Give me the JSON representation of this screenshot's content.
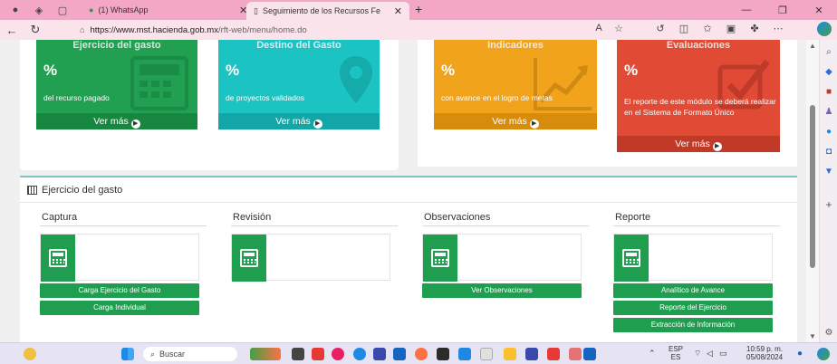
{
  "browser": {
    "tabs": [
      {
        "label": "(1) WhatsApp",
        "active": false
      },
      {
        "label": "Seguimiento de los Recursos Fe",
        "active": true
      }
    ],
    "url": {
      "host": "https://www.mst.hacienda.gob.mx",
      "path": "/rft-web/menu/home.do"
    }
  },
  "cards": [
    {
      "title": "Ejercicio del gasto",
      "value": "%",
      "desc": "del recurso pagado",
      "more": "Ver más",
      "color": "#20a050"
    },
    {
      "title": "Destino del Gasto",
      "value": "%",
      "desc": "de proyectos validados",
      "more": "Ver más",
      "color": "#1bc3c3"
    },
    {
      "title": "Indicadores",
      "value": "%",
      "desc": "con avance en el logro de metas",
      "more": "Ver más",
      "color": "#f2a31c"
    },
    {
      "title": "Evaluaciones",
      "value": "%",
      "desc": "El reporte de este módulo se deberá realizar en el Sistema de Formato Único",
      "more": "Ver más",
      "color": "#e14b36"
    }
  ],
  "section": {
    "title": "Ejercicio del gasto",
    "columns": [
      {
        "header": "Captura",
        "buttons": [
          "Carga Ejercicio del Gasto",
          "Carga Individual"
        ]
      },
      {
        "header": "Revisión",
        "buttons": []
      },
      {
        "header": "Observaciones",
        "buttons": [
          "Ver Observaciones"
        ]
      },
      {
        "header": "Reporte",
        "buttons": [
          "Analítico de Avance",
          "Reporte del Ejercicio",
          "Extracción de Información"
        ]
      }
    ]
  },
  "taskbar": {
    "search_placeholder": "Buscar",
    "lang": "ESP",
    "lang_sub": "ES",
    "time": "10:59 p. m.",
    "date": "05/08/2024"
  }
}
